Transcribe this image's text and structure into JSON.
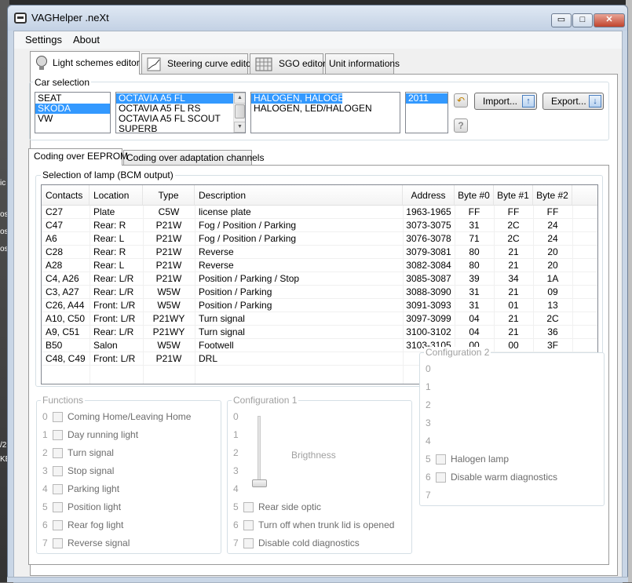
{
  "window": {
    "title": "VAGHelper .neXt",
    "min_label": "▭",
    "max_label": "□",
    "close_label": "✕"
  },
  "menu": [
    "Settings",
    "About"
  ],
  "tabs": [
    "Light schemes editor",
    "Steering curve editor",
    "SGO editor",
    "Unit informations"
  ],
  "car_selection": {
    "label": "Car selection",
    "brands": [
      "SEAT",
      "SKODA",
      "VW"
    ],
    "brand_selected": 1,
    "models": [
      "OCTAVIA A5 FL",
      "OCTAVIA A5 FL RS",
      "OCTAVIA A5 FL SCOUT",
      "SUPERB"
    ],
    "model_selected": 0,
    "lights": [
      "HALOGEN, HALOGEN",
      "HALOGEN, LED/HALOGEN"
    ],
    "light_selected": 0,
    "years": [
      "2011"
    ],
    "year_selected": 0,
    "import_label": "Import...",
    "export_label": "Export..."
  },
  "subtabs": [
    "Coding over EEPROM",
    "Coding over adaptation channels"
  ],
  "lamp_group_label": "Selection of lamp (BCM output)",
  "table": {
    "headers": [
      "Contacts",
      "Location",
      "Type",
      "Description",
      "Address",
      "Byte #0",
      "Byte #1",
      "Byte #2"
    ],
    "rows": [
      [
        "C27",
        "Plate",
        "C5W",
        "license plate",
        "1963-1965",
        "FF",
        "FF",
        "FF"
      ],
      [
        "C47",
        "Rear: R",
        "P21W",
        "Fog / Position / Parking",
        "3073-3075",
        "31",
        "2C",
        "24"
      ],
      [
        "A6",
        "Rear: L",
        "P21W",
        "Fog / Position / Parking",
        "3076-3078",
        "71",
        "2C",
        "24"
      ],
      [
        "C28",
        "Rear: R",
        "P21W",
        "Reverse",
        "3079-3081",
        "80",
        "21",
        "20"
      ],
      [
        "A28",
        "Rear: L",
        "P21W",
        "Reverse",
        "3082-3084",
        "80",
        "21",
        "20"
      ],
      [
        "C4, A26",
        "Rear: L/R",
        "P21W",
        "Position / Parking / Stop",
        "3085-3087",
        "39",
        "34",
        "1A"
      ],
      [
        "C3, A27",
        "Rear: L/R",
        "W5W",
        "Position / Parking",
        "3088-3090",
        "31",
        "21",
        "09"
      ],
      [
        "C26, A44",
        "Front: L/R",
        "W5W",
        "Position / Parking",
        "3091-3093",
        "31",
        "01",
        "13"
      ],
      [
        "A10, C50",
        "Front: L/R",
        "P21WY",
        "Turn signal",
        "3097-3099",
        "04",
        "21",
        "2C"
      ],
      [
        "A9, C51",
        "Rear: L/R",
        "P21WY",
        "Turn signal",
        "3100-3102",
        "04",
        "21",
        "36"
      ],
      [
        "B50",
        "Salon",
        "W5W",
        "Footwell",
        "3103-3105",
        "00",
        "00",
        "3F"
      ],
      [
        "C48, C49",
        "Front: L/R",
        "P21W",
        "DRL",
        "310",
        "",
        "",
        ""
      ]
    ]
  },
  "functions": {
    "label": "Functions",
    "items": [
      {
        "idx": "0",
        "label": "Coming Home/Leaving Home"
      },
      {
        "idx": "1",
        "label": "Day running light"
      },
      {
        "idx": "2",
        "label": "Turn signal"
      },
      {
        "idx": "3",
        "label": "Stop signal"
      },
      {
        "idx": "4",
        "label": "Parking light"
      },
      {
        "idx": "5",
        "label": "Position light"
      },
      {
        "idx": "6",
        "label": "Rear fog light"
      },
      {
        "idx": "7",
        "label": "Reverse signal"
      }
    ]
  },
  "config1": {
    "label": "Configuration 1",
    "slider_label": "Brigthness",
    "indices": [
      "0",
      "1",
      "2",
      "3",
      "4"
    ],
    "items": [
      {
        "idx": "5",
        "label": "Rear side optic"
      },
      {
        "idx": "6",
        "label": "Turn off when trunk lid is opened"
      },
      {
        "idx": "7",
        "label": "Disable cold diagnostics"
      }
    ]
  },
  "config2": {
    "label": "Configuration 2",
    "indices": [
      "0",
      "1",
      "2",
      "3",
      "4"
    ],
    "items": [
      {
        "idx": "5",
        "label": "Halogen lamp"
      },
      {
        "idx": "6",
        "label": "Disable warm diagnostics"
      }
    ],
    "last_index": "7"
  },
  "desktop_bits": [
    "ic",
    "os",
    "os",
    "os",
    "/2",
    "KB"
  ]
}
